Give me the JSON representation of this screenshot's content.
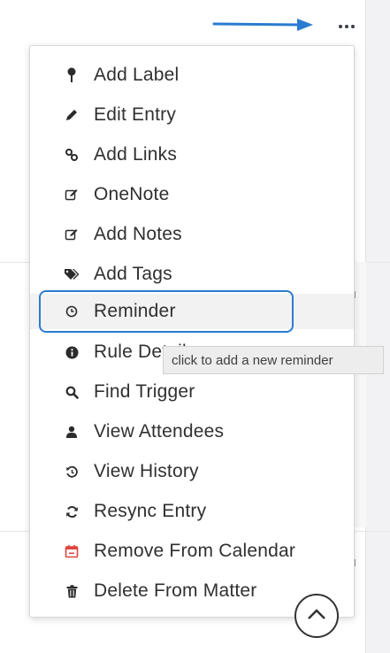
{
  "menu": {
    "items": [
      {
        "label": "Add Label",
        "icon": "pin-icon"
      },
      {
        "label": "Edit Entry",
        "icon": "pencil-icon"
      },
      {
        "label": "Add Links",
        "icon": "link-icon"
      },
      {
        "label": "OneNote",
        "icon": "edit-note-icon"
      },
      {
        "label": "Add Notes",
        "icon": "edit-note-icon"
      },
      {
        "label": "Add Tags",
        "icon": "tags-icon"
      },
      {
        "label": "Reminder",
        "icon": "clock-icon"
      },
      {
        "label": "Rule Details",
        "icon": "info-icon"
      },
      {
        "label": "Find Trigger",
        "icon": "search-icon"
      },
      {
        "label": "View Attendees",
        "icon": "user-icon"
      },
      {
        "label": "View History",
        "icon": "history-icon"
      },
      {
        "label": "Resync Entry",
        "icon": "refresh-icon"
      },
      {
        "label": "Remove From Calendar",
        "icon": "calendar-remove-icon"
      },
      {
        "label": "Delete From Matter",
        "icon": "trash-icon"
      }
    ]
  },
  "tooltip": {
    "text": "click to add a new reminder"
  },
  "colors": {
    "highlight": "#2a7ccf",
    "arrow": "#2a7ccf",
    "calendar_icon": "#e0443c",
    "icon_dark": "#2b2b2b"
  }
}
